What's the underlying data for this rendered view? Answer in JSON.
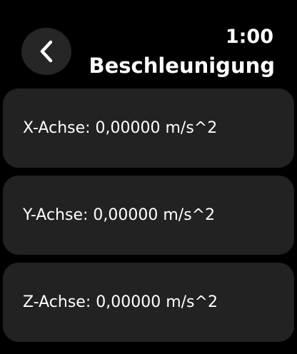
{
  "header": {
    "time": "1:00",
    "title": "Beschleunigung",
    "back_icon": "chevron-left-icon"
  },
  "readings": {
    "x": "X-Achse: 0,00000 m/s^2",
    "y": "Y-Achse: 0,00000 m/s^2",
    "z": "Z-Achse: 0,00000 m/s^2"
  },
  "colors": {
    "background": "#000000",
    "card": "#222222",
    "back_button": "#262626",
    "text": "#ffffff"
  }
}
